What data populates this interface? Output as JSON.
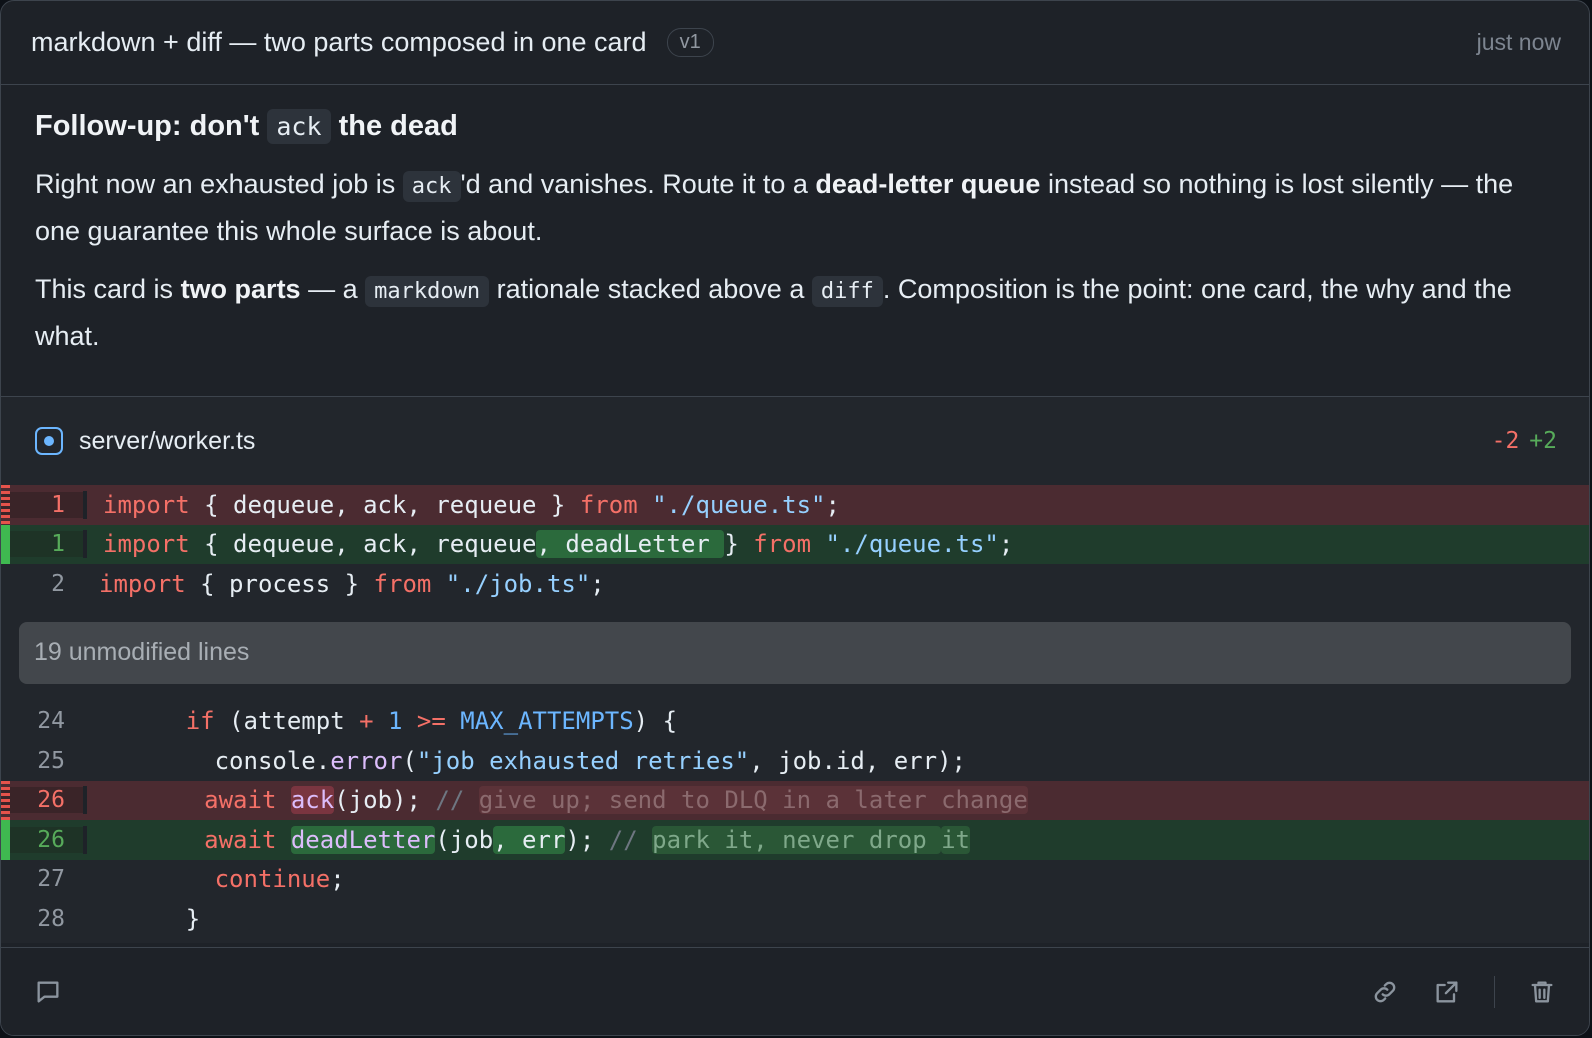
{
  "header": {
    "title": "markdown + diff — two parts composed in one card",
    "version": "v1",
    "timestamp": "just now"
  },
  "markdown": {
    "heading_pre": "Follow-up: don't",
    "heading_code": "ack",
    "heading_post": "the dead",
    "p1_a": "Right now an exhausted job is",
    "p1_code": "ack",
    "p1_b": "'d and vanishes. Route it to a",
    "p1_bold": "dead-letter queue",
    "p1_c": "instead so nothing is lost silently — the one guarantee this whole surface is about.",
    "p2_a": "This card is",
    "p2_bold": "two parts",
    "p2_b": "— a",
    "p2_code1": "markdown",
    "p2_c": "rationale stacked above a",
    "p2_code2": "diff",
    "p2_d": ". Composition is the point: one card, the why and the what."
  },
  "diff": {
    "filename": "server/worker.ts",
    "deletions": "-2",
    "additions": "+2",
    "collapsed_label": "19 unmodified lines",
    "line_numbers": [
      "1",
      "1",
      "2",
      "24",
      "25",
      "26",
      "26",
      "27",
      "28"
    ],
    "tokens": {
      "import": "import",
      "from": "from",
      "queue_path": "\"./queue.ts\"",
      "job_path": "\"./job.ts\"",
      "l1_del_body": " { dequeue, ack, requeue } ",
      "l1_add_body": " { dequeue, ack, requeue",
      "l1_add_hl": ", deadLetter ",
      "l1_add_tail": "} ",
      "l2_body": " { process } ",
      "semicolon": ";",
      "if": "if",
      "attempt": " (attempt ",
      "plus": "+",
      "one": "1",
      "gte": ">=",
      "max": "MAX_ATTEMPTS",
      "if_tail": ") {",
      "console": "console.",
      "error": "error",
      "err_msg": "\"job exhausted retries\"",
      "err_tail": ", job.id, err);",
      "await": "await",
      "ack": "ack",
      "ack_tail": "(job); ",
      "cm_slashes": "// ",
      "del_comment": "give up; send to DLQ in a later change",
      "dead_letter": "deadLetter",
      "dl_job": "(job",
      "dl_err": ", err",
      "dl_tail": "); ",
      "add_comment_a": "park it, never drop ",
      "add_comment_b": "it",
      "continue": "continue",
      "close_brace": "}"
    }
  },
  "footer": {
    "comment_icon": "comment-icon",
    "link_icon": "link-icon",
    "external_icon": "external-link-icon",
    "trash_icon": "trash-icon"
  }
}
